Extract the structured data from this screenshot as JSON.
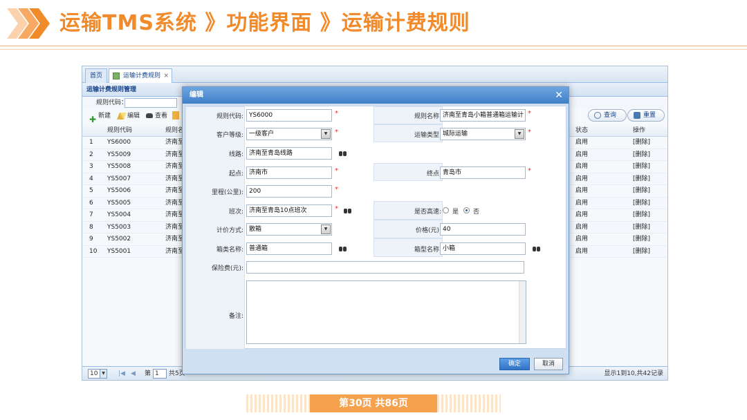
{
  "slide": {
    "title": "运输TMS系统 》功能界面 》运输计费规则",
    "page_indicator": "第30页 共86页"
  },
  "tabs": [
    {
      "label": "首页"
    },
    {
      "label": "运输计费规则",
      "close": "×"
    }
  ],
  "panel": {
    "title": "运输计费规则管理",
    "search_label": "规则代码："
  },
  "toolbar": {
    "new_label": "新建",
    "edit_label": "编辑",
    "view_label": "查看",
    "query_label": "查询",
    "reset_label": "重置"
  },
  "grid": {
    "columns": [
      "规则代码",
      "规则名",
      "状态",
      "操作"
    ],
    "rows": [
      {
        "no": "1",
        "code": "YS6000",
        "name": "济南至",
        "status": "启用",
        "action": "[删除]"
      },
      {
        "no": "2",
        "code": "YS5009",
        "name": "济南至",
        "status": "启用",
        "action": "[删除]"
      },
      {
        "no": "3",
        "code": "YS5008",
        "name": "济南至",
        "status": "启用",
        "action": "[删除]"
      },
      {
        "no": "4",
        "code": "YS5007",
        "name": "济南至",
        "status": "启用",
        "action": "[删除]"
      },
      {
        "no": "5",
        "code": "YS5006",
        "name": "济南至",
        "status": "启用",
        "action": "[删除]"
      },
      {
        "no": "6",
        "code": "YS5005",
        "name": "济南至",
        "status": "启用",
        "action": "[删除]"
      },
      {
        "no": "7",
        "code": "YS5004",
        "name": "济南至",
        "status": "启用",
        "action": "[删除]"
      },
      {
        "no": "8",
        "code": "YS5003",
        "name": "济南至",
        "status": "启用",
        "action": "[删除]"
      },
      {
        "no": "9",
        "code": "YS5002",
        "name": "济南至",
        "status": "启用",
        "action": "[删除]"
      },
      {
        "no": "10",
        "code": "YS5001",
        "name": "济南至",
        "status": "启用",
        "action": "[删除]"
      }
    ]
  },
  "pager": {
    "page_size": "10",
    "page_label": "第",
    "page_value": "1",
    "total_pages": "共5页",
    "summary": "显示1到10,共42记录"
  },
  "dialog": {
    "title": "编辑",
    "close": "✕",
    "fields": {
      "rule_code": {
        "label": "规则代码:",
        "value": "YS6000"
      },
      "rule_name": {
        "label": "规则名称:",
        "value": "济南至青岛小箱普通箱运输计"
      },
      "customer_level": {
        "label": "客户等级:",
        "value": "一级客户"
      },
      "transport_type": {
        "label": "运输类型:",
        "value": "城际运输"
      },
      "route": {
        "label": "线路:",
        "value": "济南至青岛线路"
      },
      "origin": {
        "label": "起点:",
        "value": "济南市"
      },
      "destination": {
        "label": "终点:",
        "value": "青岛市"
      },
      "mileage": {
        "label": "里程(公里):",
        "value": "200"
      },
      "shift": {
        "label": "班次:",
        "value": "济南至青岛10点班次"
      },
      "highway": {
        "label": "是否高速:",
        "opt_yes": "是",
        "opt_no": "否",
        "selected": "否"
      },
      "pricing": {
        "label": "计价方式:",
        "value": "散箱"
      },
      "price": {
        "label": "价格(元):",
        "value": "40"
      },
      "box_class": {
        "label": "箱类名称:",
        "value": "普通箱"
      },
      "box_type": {
        "label": "箱型名称:",
        "value": "小箱"
      },
      "insurance": {
        "label": "保险费(元):",
        "value": ""
      },
      "remark": {
        "label": "备注:",
        "value": ""
      }
    },
    "confirm_label": "确定",
    "cancel_label": "取消"
  },
  "colors": {
    "accent": "#f08a2a",
    "dialog_header": "#3f7fc8",
    "required": "#e03030"
  }
}
